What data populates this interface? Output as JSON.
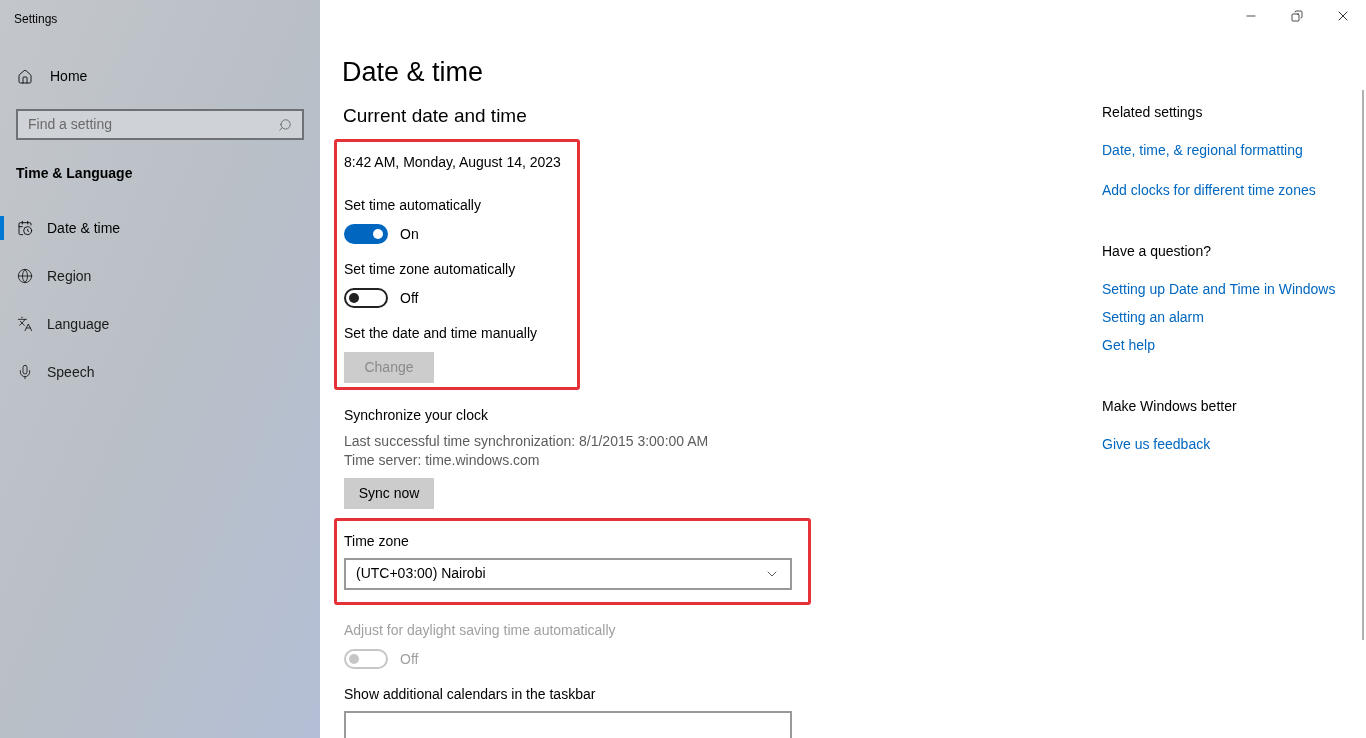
{
  "window": {
    "title": "Settings"
  },
  "sidebar": {
    "home": "Home",
    "search": {
      "placeholder": "Find a setting"
    },
    "section": "Time & Language",
    "items": [
      {
        "label": "Date & time",
        "selected": true
      },
      {
        "label": "Region",
        "selected": false
      },
      {
        "label": "Language",
        "selected": false
      },
      {
        "label": "Speech",
        "selected": false
      }
    ]
  },
  "main": {
    "title": "Date & time",
    "section_title": "Current date and time",
    "groups": [
      {
        "highlighted": true,
        "items": [
          {
            "kind": "text",
            "text": "8:42 AM, Monday, August 14, 2023"
          },
          {
            "kind": "toggle",
            "label": "Set time automatically",
            "on": true,
            "disabled": false,
            "state_text": "On"
          },
          {
            "kind": "toggle",
            "label": "Set time zone automatically",
            "on": false,
            "disabled": false,
            "state_text": "Off"
          },
          {
            "kind": "button",
            "label": "Set the date and time manually",
            "button": "Change",
            "disabled": true
          }
        ]
      },
      {
        "highlighted": false,
        "items": [
          {
            "kind": "sync",
            "label": "Synchronize your clock",
            "lines": [
              "Last successful time synchronization: 8/1/2015 3:00:00 AM",
              "Time server: time.windows.com"
            ],
            "button": "Sync now",
            "disabled": false
          }
        ]
      },
      {
        "highlighted": true,
        "items": [
          {
            "kind": "dropdown",
            "label": "Time zone",
            "value": "(UTC+03:00) Nairobi"
          }
        ]
      },
      {
        "highlighted": false,
        "items": [
          {
            "kind": "toggle",
            "label": "Adjust for daylight saving time automatically",
            "on": false,
            "disabled": true,
            "state_text": "Off"
          },
          {
            "kind": "dropdown",
            "label": "Show additional calendars in the taskbar"
          }
        ]
      }
    ]
  },
  "related": [
    {
      "heading": "Related settings",
      "links": [
        "Date, time, & regional formatting",
        "Add clocks for different time zones"
      ]
    },
    {
      "heading": "Have a question?",
      "links": [
        "Setting up Date and Time in Windows",
        "Setting an alarm",
        "Get help"
      ]
    },
    {
      "heading": "Make Windows better",
      "links": [
        "Give us feedback"
      ]
    }
  ]
}
